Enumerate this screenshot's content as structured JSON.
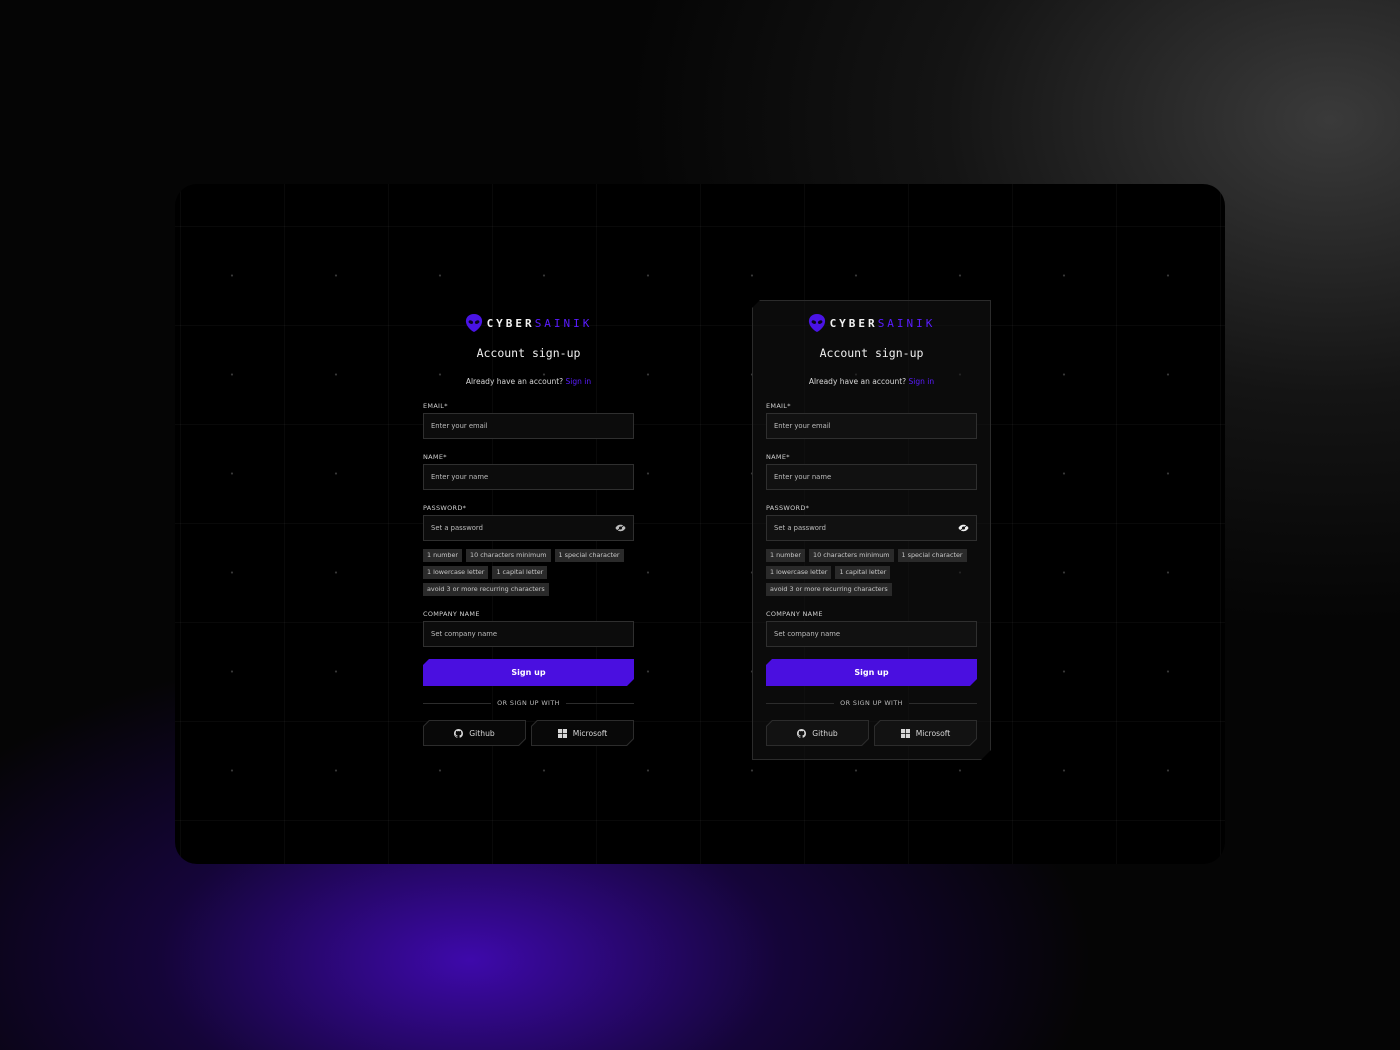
{
  "brand": {
    "part1": "CYBER",
    "part2": "SAINIK",
    "accent": "#5a1cff"
  },
  "cards": [
    {
      "title": "Account sign-up",
      "signin_prompt": "Already have an account?",
      "signin_link": "Sign in",
      "email": {
        "label": "EMAIL*",
        "placeholder": "Enter your email"
      },
      "name": {
        "label": "NAME*",
        "placeholder": "Enter your name"
      },
      "password": {
        "label": "PASSWORD*",
        "placeholder": "Set a password",
        "icon": "eye-icon"
      },
      "requirements": [
        "1 number",
        "10 characters minimum",
        "1 special character",
        "1 lowercase letter",
        "1 capital letter",
        "avoid 3 or more recurring characters"
      ],
      "company": {
        "label": "COMPANY NAME",
        "placeholder": "Set company name"
      },
      "submit": "Sign up",
      "divider": "OR SIGN UP WITH",
      "github": "Github",
      "microsoft": "Microsoft"
    },
    {
      "title": "Account sign-up",
      "signin_prompt": "Already have an account?",
      "signin_link": "Sign in",
      "email": {
        "label": "EMAIL*",
        "placeholder": "Enter your email"
      },
      "name": {
        "label": "NAME*",
        "placeholder": "Enter your name"
      },
      "password": {
        "label": "PASSWORD*",
        "placeholder": "Set a password",
        "icon": "eye-icon"
      },
      "requirements": [
        "1 number",
        "10 characters minimum",
        "1 special character",
        "1 lowercase letter",
        "1 capital letter",
        "avoid 3 or more recurring characters"
      ],
      "company": {
        "label": "COMPANY NAME",
        "placeholder": "Set company name"
      },
      "submit": "Sign up",
      "divider": "OR SIGN UP WITH",
      "github": "Github",
      "microsoft": "Microsoft"
    }
  ]
}
